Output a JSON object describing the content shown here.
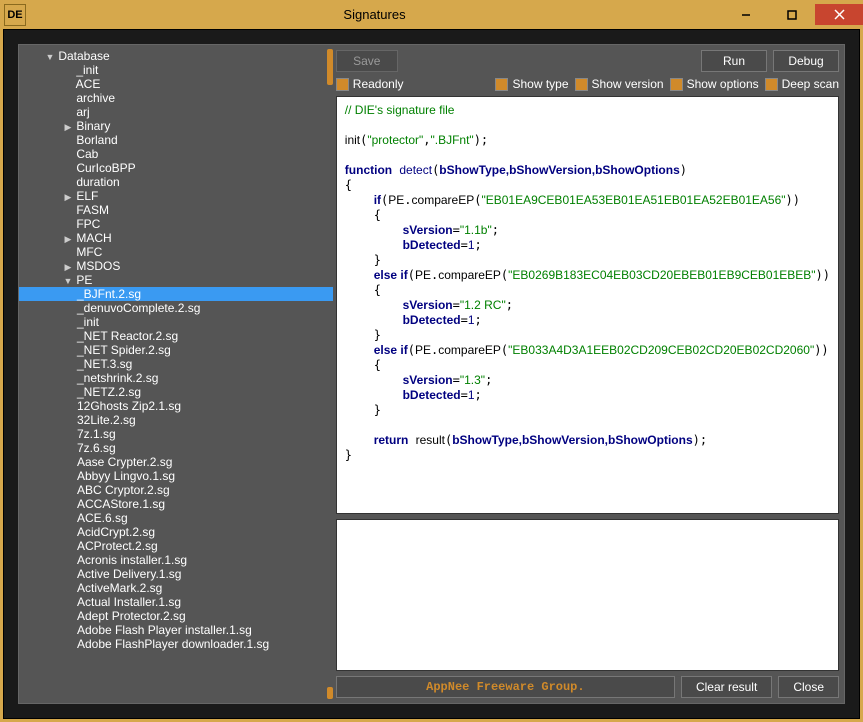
{
  "window": {
    "title": "Signatures",
    "icon": "DE"
  },
  "toolbar": {
    "save": "Save",
    "run": "Run",
    "debug": "Debug",
    "readonly": "Readonly",
    "showtype": "Show type",
    "showversion": "Show version",
    "showoptions": "Show options",
    "deepscan": "Deep scan"
  },
  "bottom": {
    "status": "AppNee Freeware Group.",
    "clear": "Clear result",
    "close": "Close"
  },
  "tree": {
    "root": "Database",
    "items": [
      {
        "label": "_init",
        "d": 2
      },
      {
        "label": "ACE",
        "d": 2
      },
      {
        "label": "archive",
        "d": 2
      },
      {
        "label": "arj",
        "d": 2
      },
      {
        "label": "Binary",
        "d": 2,
        "caret": "right"
      },
      {
        "label": "Borland",
        "d": 2
      },
      {
        "label": "Cab",
        "d": 2
      },
      {
        "label": "CurIcoBPP",
        "d": 2
      },
      {
        "label": "duration",
        "d": 2
      },
      {
        "label": "ELF",
        "d": 2,
        "caret": "right"
      },
      {
        "label": "FASM",
        "d": 2
      },
      {
        "label": "FPC",
        "d": 2
      },
      {
        "label": "MACH",
        "d": 2,
        "caret": "right"
      },
      {
        "label": "MFC",
        "d": 2
      },
      {
        "label": "MSDOS",
        "d": 2,
        "caret": "right"
      },
      {
        "label": "PE",
        "d": 2,
        "caret": "down"
      },
      {
        "label": "_BJFnt.2.sg",
        "d": 3,
        "selected": true
      },
      {
        "label": "_denuvoComplete.2.sg",
        "d": 3
      },
      {
        "label": "_init",
        "d": 3
      },
      {
        "label": "_NET Reactor.2.sg",
        "d": 3
      },
      {
        "label": "_NET Spider.2.sg",
        "d": 3
      },
      {
        "label": "_NET.3.sg",
        "d": 3
      },
      {
        "label": "_netshrink.2.sg",
        "d": 3
      },
      {
        "label": "_NETZ.2.sg",
        "d": 3
      },
      {
        "label": "12Ghosts Zip2.1.sg",
        "d": 3
      },
      {
        "label": "32Lite.2.sg",
        "d": 3
      },
      {
        "label": "7z.1.sg",
        "d": 3
      },
      {
        "label": "7z.6.sg",
        "d": 3
      },
      {
        "label": "Aase Crypter.2.sg",
        "d": 3
      },
      {
        "label": "Abbyy Lingvo.1.sg",
        "d": 3
      },
      {
        "label": "ABC Cryptor.2.sg",
        "d": 3
      },
      {
        "label": "ACCAStore.1.sg",
        "d": 3
      },
      {
        "label": "ACE.6.sg",
        "d": 3
      },
      {
        "label": "AcidCrypt.2.sg",
        "d": 3
      },
      {
        "label": "ACProtect.2.sg",
        "d": 3
      },
      {
        "label": "Acronis installer.1.sg",
        "d": 3
      },
      {
        "label": "Active Delivery.1.sg",
        "d": 3
      },
      {
        "label": "ActiveMark.2.sg",
        "d": 3
      },
      {
        "label": "Actual Installer.1.sg",
        "d": 3
      },
      {
        "label": "Adept Protector.2.sg",
        "d": 3
      },
      {
        "label": "Adobe Flash Player installer.1.sg",
        "d": 3
      },
      {
        "label": "Adobe FlashPlayer downloader.1.sg",
        "d": 3
      }
    ]
  },
  "code": {
    "comment": "// DIE's signature file",
    "init_fn": "init",
    "init_arg1": "\"protector\"",
    "init_arg2": "\".BJFnt\"",
    "kw_function": "function",
    "fn_name": "detect",
    "params": "bShowType,bShowVersion,bShowOptions",
    "kw_if": "if",
    "kw_elseif": "else if",
    "kw_return": "return",
    "pe": "PE",
    "cmp": "compareEP",
    "ep1": "\"EB01EA9CEB01EA53EB01EA51EB01EA52EB01EA56\"",
    "ep2": "\"EB0269B183EC04EB03CD20EBEB01EB9CEB01EBEB\"",
    "ep3": "\"EB033A4D3A1EEB02CD209CEB02CD20EB02CD2060\"",
    "sver": "sVersion",
    "v1": "\"1.1b\"",
    "v2": "\"1.2 RC\"",
    "v3": "\"1.3\"",
    "bdet": "bDetected",
    "one": "1",
    "result": "result"
  }
}
